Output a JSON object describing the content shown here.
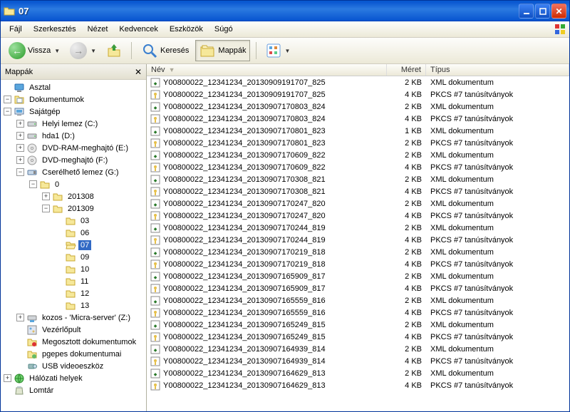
{
  "window": {
    "title": "07"
  },
  "menu": [
    "Fájl",
    "Szerkesztés",
    "Nézet",
    "Kedvencek",
    "Eszközök",
    "Súgó"
  ],
  "toolbar": {
    "back": "Vissza",
    "search": "Keresés",
    "folders": "Mappák"
  },
  "panel": {
    "title": "Mappák"
  },
  "tree": [
    {
      "depth": 0,
      "toggle": null,
      "icon": "desktop",
      "label": "Asztal"
    },
    {
      "depth": 0,
      "toggle": "-",
      "icon": "mydocs",
      "label": "Dokumentumok"
    },
    {
      "depth": 0,
      "toggle": "-",
      "icon": "computer",
      "label": "Sajátgép"
    },
    {
      "depth": 1,
      "toggle": "+",
      "icon": "hdd",
      "label": "Helyi lemez (C:)"
    },
    {
      "depth": 1,
      "toggle": "+",
      "icon": "hdd",
      "label": "hda1 (D:)"
    },
    {
      "depth": 1,
      "toggle": "+",
      "icon": "dvd",
      "label": "DVD-RAM-meghajtó (E:)"
    },
    {
      "depth": 1,
      "toggle": "+",
      "icon": "dvd",
      "label": "DVD-meghajtó (F:)"
    },
    {
      "depth": 1,
      "toggle": "-",
      "icon": "removable",
      "label": "Cserélhető lemez (G:)"
    },
    {
      "depth": 2,
      "toggle": "-",
      "icon": "folder",
      "label": "0"
    },
    {
      "depth": 3,
      "toggle": "+",
      "icon": "folder",
      "label": "201308"
    },
    {
      "depth": 3,
      "toggle": "-",
      "icon": "folder",
      "label": "201309"
    },
    {
      "depth": 4,
      "toggle": null,
      "icon": "folder",
      "label": "03"
    },
    {
      "depth": 4,
      "toggle": null,
      "icon": "folder",
      "label": "06"
    },
    {
      "depth": 4,
      "toggle": null,
      "icon": "folder-open",
      "label": "07",
      "selected": true
    },
    {
      "depth": 4,
      "toggle": null,
      "icon": "folder",
      "label": "09"
    },
    {
      "depth": 4,
      "toggle": null,
      "icon": "folder",
      "label": "10"
    },
    {
      "depth": 4,
      "toggle": null,
      "icon": "folder",
      "label": "11"
    },
    {
      "depth": 4,
      "toggle": null,
      "icon": "folder",
      "label": "12"
    },
    {
      "depth": 4,
      "toggle": null,
      "icon": "folder",
      "label": "13"
    },
    {
      "depth": 1,
      "toggle": "+",
      "icon": "netdrive",
      "label": "kozos - 'Micra-server' (Z:)"
    },
    {
      "depth": 1,
      "toggle": null,
      "icon": "cpanel",
      "label": "Vezérlőpult"
    },
    {
      "depth": 1,
      "toggle": null,
      "icon": "shared",
      "label": "Megosztott dokumentumok"
    },
    {
      "depth": 1,
      "toggle": null,
      "icon": "userdocs",
      "label": "pgepes dokumentumai"
    },
    {
      "depth": 1,
      "toggle": null,
      "icon": "usbcam",
      "label": "USB videoeszköz"
    },
    {
      "depth": 0,
      "toggle": "+",
      "icon": "network",
      "label": "Hálózati helyek"
    },
    {
      "depth": 0,
      "toggle": null,
      "icon": "recycle",
      "label": "Lomtár"
    }
  ],
  "columns": {
    "name": "Név",
    "size": "Méret",
    "type": "Típus"
  },
  "types": {
    "xml": "XML dokumentum",
    "pkcs": "PKCS #7 tanúsítványok"
  },
  "files": [
    {
      "name": "Y00800022_12341234_20130909191707_825",
      "size": "2 KB",
      "type": "xml"
    },
    {
      "name": "Y00800022_12341234_20130909191707_825",
      "size": "4 KB",
      "type": "pkcs"
    },
    {
      "name": "Y00800022_12341234_20130907170803_824",
      "size": "2 KB",
      "type": "xml"
    },
    {
      "name": "Y00800022_12341234_20130907170803_824",
      "size": "4 KB",
      "type": "pkcs"
    },
    {
      "name": "Y00800022_12341234_20130907170801_823",
      "size": "1 KB",
      "type": "xml"
    },
    {
      "name": "Y00800022_12341234_20130907170801_823",
      "size": "2 KB",
      "type": "pkcs"
    },
    {
      "name": "Y00800022_12341234_20130907170609_822",
      "size": "2 KB",
      "type": "xml"
    },
    {
      "name": "Y00800022_12341234_20130907170609_822",
      "size": "4 KB",
      "type": "pkcs"
    },
    {
      "name": "Y00800022_12341234_20130907170308_821",
      "size": "2 KB",
      "type": "xml"
    },
    {
      "name": "Y00800022_12341234_20130907170308_821",
      "size": "4 KB",
      "type": "pkcs"
    },
    {
      "name": "Y00800022_12341234_20130907170247_820",
      "size": "2 KB",
      "type": "xml"
    },
    {
      "name": "Y00800022_12341234_20130907170247_820",
      "size": "4 KB",
      "type": "pkcs"
    },
    {
      "name": "Y00800022_12341234_20130907170244_819",
      "size": "2 KB",
      "type": "xml"
    },
    {
      "name": "Y00800022_12341234_20130907170244_819",
      "size": "4 KB",
      "type": "pkcs"
    },
    {
      "name": "Y00800022_12341234_20130907170219_818",
      "size": "2 KB",
      "type": "xml"
    },
    {
      "name": "Y00800022_12341234_20130907170219_818",
      "size": "4 KB",
      "type": "pkcs"
    },
    {
      "name": "Y00800022_12341234_20130907165909_817",
      "size": "2 KB",
      "type": "xml"
    },
    {
      "name": "Y00800022_12341234_20130907165909_817",
      "size": "4 KB",
      "type": "pkcs"
    },
    {
      "name": "Y00800022_12341234_20130907165559_816",
      "size": "2 KB",
      "type": "xml"
    },
    {
      "name": "Y00800022_12341234_20130907165559_816",
      "size": "4 KB",
      "type": "pkcs"
    },
    {
      "name": "Y00800022_12341234_20130907165249_815",
      "size": "2 KB",
      "type": "xml"
    },
    {
      "name": "Y00800022_12341234_20130907165249_815",
      "size": "4 KB",
      "type": "pkcs"
    },
    {
      "name": "Y00800022_12341234_20130907164939_814",
      "size": "2 KB",
      "type": "xml"
    },
    {
      "name": "Y00800022_12341234_20130907164939_814",
      "size": "4 KB",
      "type": "pkcs"
    },
    {
      "name": "Y00800022_12341234_20130907164629_813",
      "size": "2 KB",
      "type": "xml"
    },
    {
      "name": "Y00800022_12341234_20130907164629_813",
      "size": "4 KB",
      "type": "pkcs"
    }
  ]
}
